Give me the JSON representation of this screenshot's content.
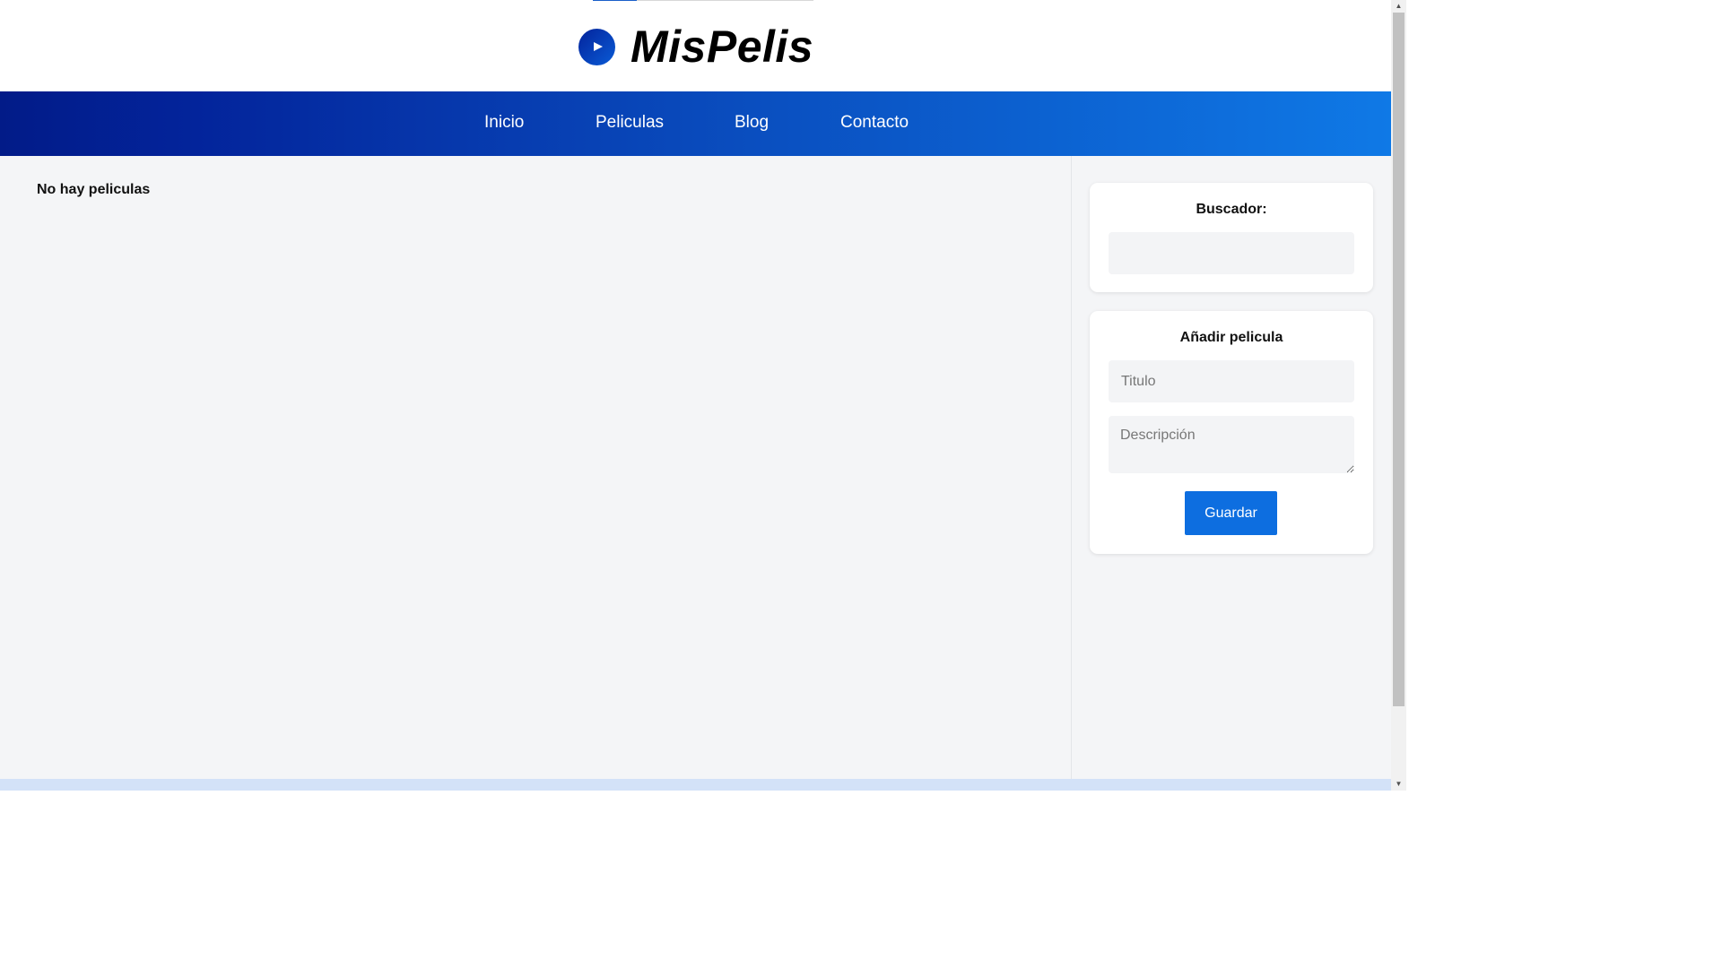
{
  "header": {
    "logo_text": "MisPelis",
    "logo_icon": "play-icon"
  },
  "nav": {
    "items": [
      {
        "label": "Inicio"
      },
      {
        "label": "Peliculas"
      },
      {
        "label": "Blog"
      },
      {
        "label": "Contacto"
      }
    ]
  },
  "main": {
    "empty_message": "No hay peliculas"
  },
  "sidebar": {
    "search": {
      "title": "Buscador:",
      "value": "",
      "placeholder": ""
    },
    "add_form": {
      "title": "Añadir pelicula",
      "title_placeholder": "Titulo",
      "description_placeholder": "Descripción",
      "save_label": "Guardar"
    }
  },
  "colors": {
    "brand_dark": "#021b88",
    "brand_light": "#0f79e6",
    "button": "#0d6ee0",
    "background": "#f4f5f7"
  }
}
